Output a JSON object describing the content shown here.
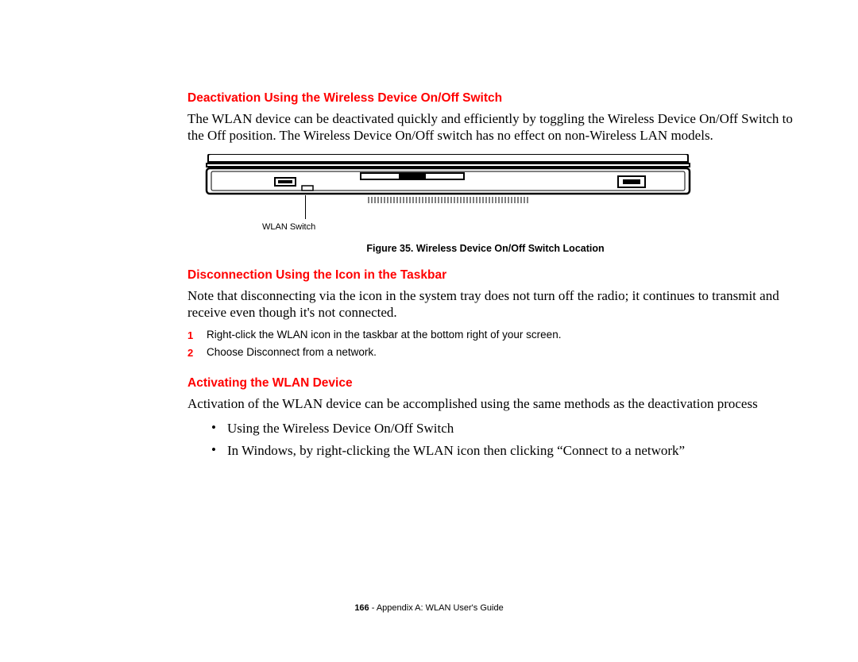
{
  "section1": {
    "heading": "Deactivation Using the Wireless Device On/Off Switch",
    "body": "The WLAN device can be deactivated quickly and efficiently by toggling the Wireless Device On/Off Switch to the Off position. The Wireless Device On/Off switch has no effect on non-Wireless LAN models."
  },
  "figure": {
    "callout": "WLAN Switch",
    "caption": "Figure 35.  Wireless Device On/Off Switch Location"
  },
  "section2": {
    "heading": "Disconnection Using the Icon in the Taskbar",
    "body": "Note that disconnecting via the icon in the system tray does not turn off the radio; it continues to transmit and receive even though it's not connected.",
    "steps": [
      {
        "num": "1",
        "text": "Right-click the WLAN icon in the taskbar at the bottom right of your screen."
      },
      {
        "num": "2",
        "text": "Choose Disconnect from a network."
      }
    ]
  },
  "section3": {
    "heading": "Activating the WLAN Device",
    "body": "Activation of the WLAN device can be accomplished using the same methods as the deactivation process",
    "bullets": [
      "Using the Wireless Device On/Off Switch",
      "In Windows, by right-clicking the WLAN icon then clicking “Connect to a network”"
    ]
  },
  "footer": {
    "page": "166",
    "sep": " - ",
    "text": "Appendix A: WLAN User's Guide"
  }
}
